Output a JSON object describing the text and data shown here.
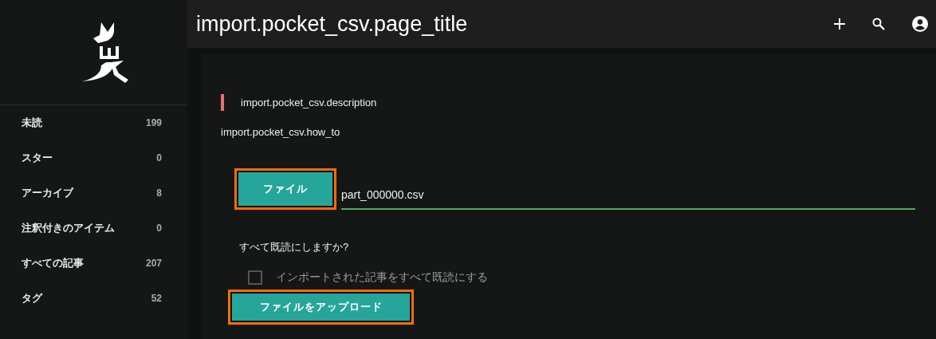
{
  "header": {
    "title": "import.pocket_csv.page_title"
  },
  "sidebar": {
    "items": [
      {
        "label": "未読",
        "count": "199"
      },
      {
        "label": "スター",
        "count": "0"
      },
      {
        "label": "アーカイブ",
        "count": "8"
      },
      {
        "label": "注釈付きのアイテム",
        "count": "0"
      },
      {
        "label": "すべての記事",
        "count": "207"
      },
      {
        "label": "タグ",
        "count": "52"
      }
    ]
  },
  "content": {
    "description": "import.pocket_csv.description",
    "how_to": "import.pocket_csv.how_to",
    "file_button": {
      "label": "ファイル",
      "highlighted": true
    },
    "file_name": "part_000000.csv",
    "mark_read_question": "すべて既読にしますか?",
    "mark_read_checkbox": {
      "label": "インポートされた記事をすべて既読にする",
      "checked": false
    },
    "upload_button": {
      "label": "ファイルをアップロード",
      "highlighted": true
    }
  }
}
